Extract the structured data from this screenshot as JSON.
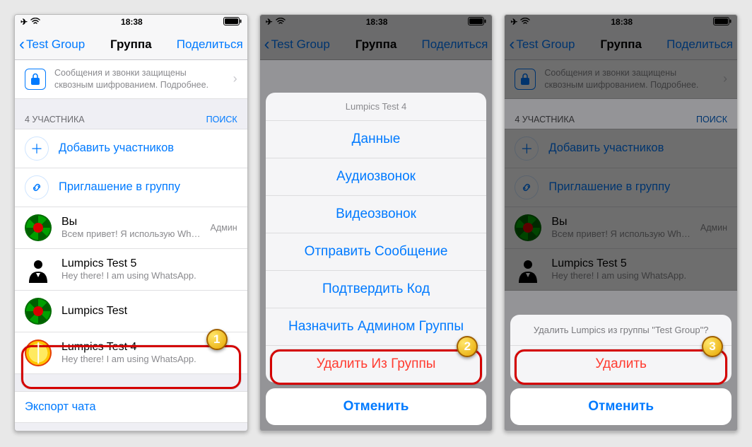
{
  "status": {
    "time": "18:38"
  },
  "nav": {
    "back": "Test Group",
    "title": "Группа",
    "share": "Поделиться"
  },
  "encryption": "Сообщения и звонки защищены сквозным шифрованием. Подробнее.",
  "participants_header": {
    "count": "4 УЧАСТНИКА",
    "search": "ПОИСК"
  },
  "actions": {
    "add": "Добавить участников",
    "invite": "Приглашение в группу"
  },
  "members": {
    "you": {
      "name": "Вы",
      "status": "Всем привет! Я использую Wh…",
      "admin": "Админ"
    },
    "m1": {
      "name": "Lumpics Test 5",
      "status": "Hey there! I am using WhatsApp."
    },
    "m2": {
      "name": "Lumpics Test",
      "status": ""
    },
    "m3": {
      "name": "Lumpics Test 4",
      "status": "Hey there! I am using WhatsApp."
    }
  },
  "export": "Экспорт чата",
  "sheet1": {
    "title": "Lumpics Test 4",
    "data": "Данные",
    "audio": "Аудиозвонок",
    "video": "Видеозвонок",
    "send": "Отправить Сообщение",
    "confirm": "Подтвердить Код",
    "make_admin": "Назначить Админом Группы",
    "remove": "Удалить Из Группы",
    "cancel": "Отменить"
  },
  "sheet2": {
    "title": "Удалить Lumpics из группы \"Test Group\"?",
    "delete": "Удалить",
    "cancel": "Отменить"
  },
  "badges": {
    "b1": "1",
    "b2": "2",
    "b3": "3"
  }
}
